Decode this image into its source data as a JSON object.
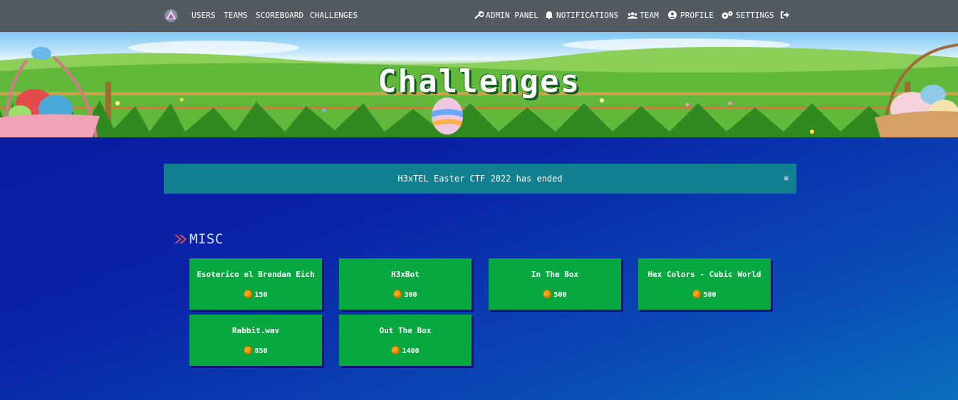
{
  "nav": {
    "left": [
      {
        "label": "USERS"
      },
      {
        "label": "TEAMS"
      },
      {
        "label": "SCOREBOARD"
      },
      {
        "label": "CHALLENGES"
      }
    ],
    "right": {
      "admin": "ADMIN PANEL",
      "notifications": "NOTIFICATIONS",
      "team": "TEAM",
      "profile": "PROFILE",
      "settings": "SETTINGS"
    }
  },
  "hero": {
    "title": "Challenges"
  },
  "alert": {
    "text": "H3xTEL Easter CTF 2022 has ended",
    "close": "✖"
  },
  "category": {
    "name": "MISC"
  },
  "challenges": [
    {
      "name": "Esoterico el Brendan Eich",
      "points": "150"
    },
    {
      "name": "H3xBot",
      "points": "300"
    },
    {
      "name": "In The Box",
      "points": "500"
    },
    {
      "name": "Hex Colors - Cubic World",
      "points": "500"
    },
    {
      "name": "Rabbit.wav",
      "points": "850"
    },
    {
      "name": "Out The Box",
      "points": "1400"
    }
  ],
  "colors": {
    "navbar": "#535a61",
    "card": "#08a840",
    "alert": "#118192",
    "accent_chevron": "#d9534f"
  }
}
